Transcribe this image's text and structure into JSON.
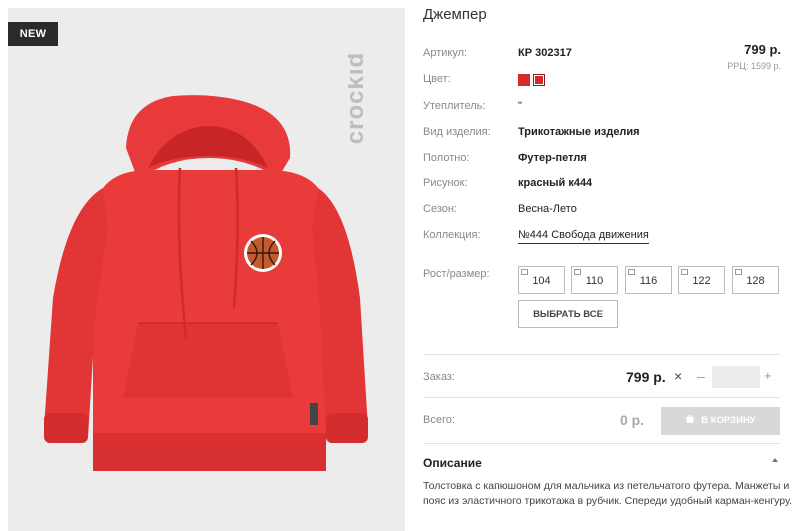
{
  "badge": {
    "label": "NEW"
  },
  "brand": {
    "name": "crockid"
  },
  "product": {
    "title": "Джемпер",
    "price": "799 р.",
    "rrp": "РРЦ: 1599 р."
  },
  "attributes": [
    {
      "label": "Артикул:",
      "value": "КР 302317"
    },
    {
      "label": "Цвет:",
      "value": ""
    },
    {
      "label": "Утеплитель:",
      "value": "\""
    },
    {
      "label": "Вид изделия:",
      "value": "Трикотажные изделия"
    },
    {
      "label": "Полотно:",
      "value": "Футер-петля"
    },
    {
      "label": "Рисунок:",
      "value": "красный к444"
    },
    {
      "label": "Сезон:",
      "value": "Весна-Лето"
    },
    {
      "label": "Коллекция:",
      "value": "№444 Свобода движения"
    }
  ],
  "colors": {
    "swatch": "#d32a2a",
    "accent": "#d32a2a",
    "cart_disabled": "#d8d8d8"
  },
  "sizes": {
    "label": "Рост/размер:",
    "options": [
      "104",
      "110",
      "116",
      "122",
      "128"
    ],
    "select_all": "ВЫБРАТЬ ВСЕ"
  },
  "order": {
    "label": "Заказ:",
    "price": "799 р.",
    "times": "×",
    "minus": "–",
    "plus": "+",
    "quantity": ""
  },
  "total": {
    "label": "Всего:",
    "value": "0 р.",
    "cart_button": "В КОРЗИНУ"
  },
  "description": {
    "title": "Описание",
    "text": "Толстовка с капюшоном для мальчика из петельчатого футера. Манжеты и пояс из эластичного трикотажа в рубчик. Спереди удобный карман-кенгуру."
  }
}
